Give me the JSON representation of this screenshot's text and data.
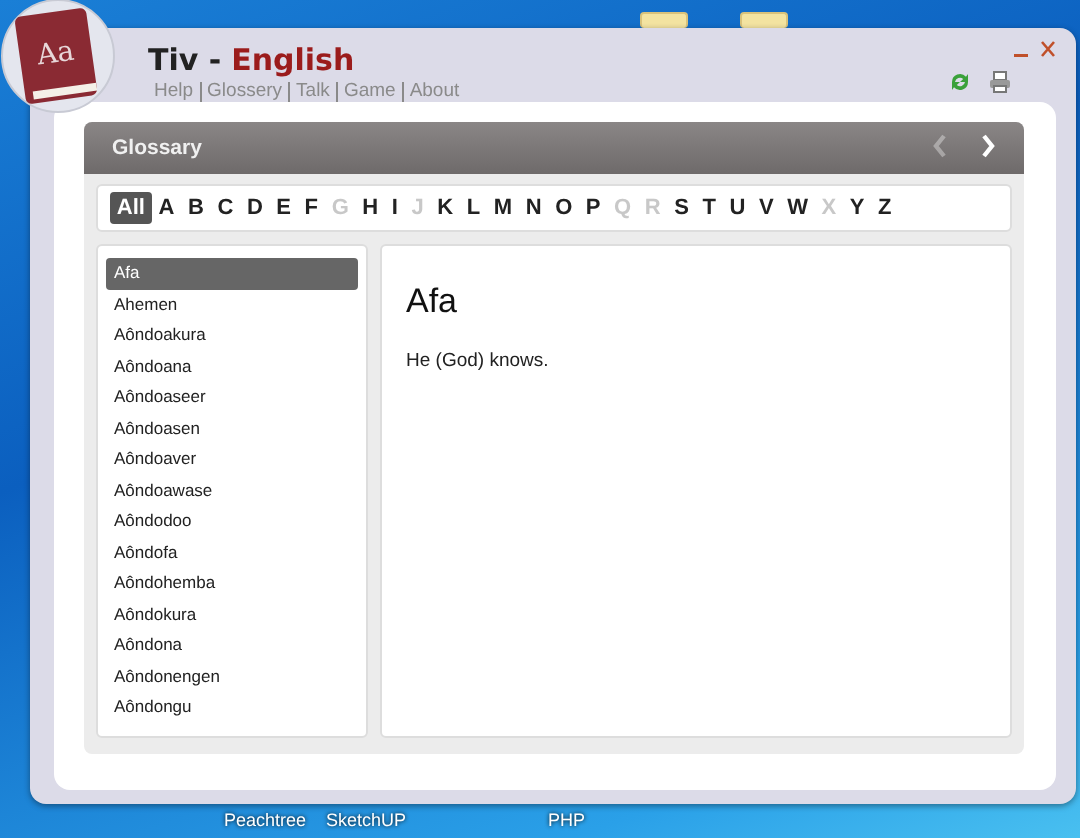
{
  "desktop": {
    "icons": [
      {
        "label": "Peachtree"
      },
      {
        "label": "SketchUP"
      },
      {
        "label": "PHP"
      }
    ]
  },
  "window": {
    "logo_text": "Aa",
    "title_part_1": "Tiv -",
    "title_part_2": "English"
  },
  "menu": [
    {
      "label": "Help",
      "separator_after": true
    },
    {
      "label": "Glossery",
      "separator_after": true
    },
    {
      "label": "Talk",
      "separator_after": true
    },
    {
      "label": "Game",
      "separator_after": true
    },
    {
      "label": "About",
      "separator_after": false
    }
  ],
  "glossary": {
    "title": "Glossary",
    "prev_disabled": true,
    "next_disabled": false,
    "letters": [
      {
        "label": "All",
        "selected": true,
        "disabled": false
      },
      {
        "label": "A",
        "selected": false,
        "disabled": false
      },
      {
        "label": "B",
        "selected": false,
        "disabled": false
      },
      {
        "label": "C",
        "selected": false,
        "disabled": false
      },
      {
        "label": "D",
        "selected": false,
        "disabled": false
      },
      {
        "label": "E",
        "selected": false,
        "disabled": false
      },
      {
        "label": "F",
        "selected": false,
        "disabled": false
      },
      {
        "label": "G",
        "selected": false,
        "disabled": true
      },
      {
        "label": "H",
        "selected": false,
        "disabled": false
      },
      {
        "label": "I",
        "selected": false,
        "disabled": false
      },
      {
        "label": "J",
        "selected": false,
        "disabled": true
      },
      {
        "label": "K",
        "selected": false,
        "disabled": false
      },
      {
        "label": "L",
        "selected": false,
        "disabled": false
      },
      {
        "label": "M",
        "selected": false,
        "disabled": false
      },
      {
        "label": "N",
        "selected": false,
        "disabled": false
      },
      {
        "label": "O",
        "selected": false,
        "disabled": false
      },
      {
        "label": "P",
        "selected": false,
        "disabled": false
      },
      {
        "label": "Q",
        "selected": false,
        "disabled": true
      },
      {
        "label": "R",
        "selected": false,
        "disabled": true
      },
      {
        "label": "S",
        "selected": false,
        "disabled": false
      },
      {
        "label": "T",
        "selected": false,
        "disabled": false
      },
      {
        "label": "U",
        "selected": false,
        "disabled": false
      },
      {
        "label": "V",
        "selected": false,
        "disabled": false
      },
      {
        "label": "W",
        "selected": false,
        "disabled": false
      },
      {
        "label": "X",
        "selected": false,
        "disabled": true
      },
      {
        "label": "Y",
        "selected": false,
        "disabled": false
      },
      {
        "label": "Z",
        "selected": false,
        "disabled": false
      }
    ],
    "words": [
      {
        "label": "Afa",
        "selected": true
      },
      {
        "label": "Ahemen",
        "selected": false
      },
      {
        "label": "Aôndoakura",
        "selected": false
      },
      {
        "label": "Aôndoana",
        "selected": false
      },
      {
        "label": "Aôndoaseer",
        "selected": false
      },
      {
        "label": "Aôndoasen",
        "selected": false
      },
      {
        "label": "Aôndoaver",
        "selected": false
      },
      {
        "label": "Aôndoawase",
        "selected": false
      },
      {
        "label": "Aôndodoo",
        "selected": false
      },
      {
        "label": "Aôndofa",
        "selected": false
      },
      {
        "label": "Aôndohemba",
        "selected": false
      },
      {
        "label": "Aôndokura",
        "selected": false
      },
      {
        "label": "Aôndona",
        "selected": false
      },
      {
        "label": "Aôndonengen",
        "selected": false
      },
      {
        "label": "Aôndongu",
        "selected": false
      }
    ],
    "entry": {
      "word": "Afa",
      "definition": "He (God) knows."
    }
  }
}
